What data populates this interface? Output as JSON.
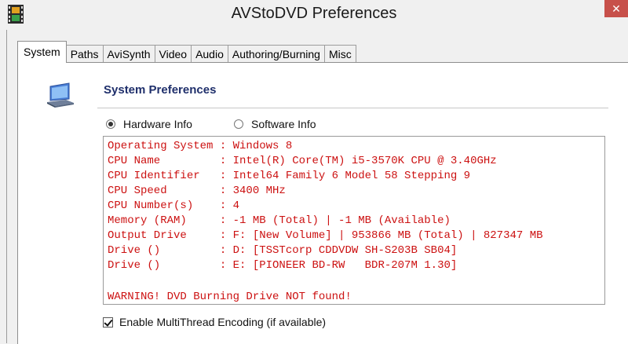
{
  "window": {
    "title": "AVStoDVD Preferences"
  },
  "tabs": [
    {
      "label": "System",
      "active": true
    },
    {
      "label": "Paths"
    },
    {
      "label": "AviSynth"
    },
    {
      "label": "Video"
    },
    {
      "label": "Audio"
    },
    {
      "label": "Authoring/Burning"
    },
    {
      "label": "Misc"
    }
  ],
  "section": {
    "title": "System Preferences"
  },
  "radios": [
    {
      "label": "Hardware Info",
      "checked": true
    },
    {
      "label": "Software Info",
      "checked": false
    }
  ],
  "info_lines": [
    "Operating System : Windows 8",
    "CPU Name         : Intel(R) Core(TM) i5-3570K CPU @ 3.40GHz",
    "CPU Identifier   : Intel64 Family 6 Model 58 Stepping 9",
    "CPU Speed        : 3400 MHz",
    "CPU Number(s)    : 4",
    "Memory (RAM)     : -1 MB (Total) | -1 MB (Available)",
    "Output Drive     : F: [New Volume] | 953866 MB (Total) | 827347 MB",
    "Drive ()         : D: [TSSTcorp CDDVDW SH-S203B SB04]",
    "Drive ()         : E: [PIONEER BD-RW   BDR-207M 1.30]",
    "",
    "WARNING! DVD Burning Drive NOT found!"
  ],
  "multithread": {
    "label": "Enable MultiThread Encoding (if available)",
    "checked": true
  },
  "colors": {
    "info_text": "#cc1111",
    "section_title": "#1f2f6b",
    "close_button": "#c7504a"
  }
}
